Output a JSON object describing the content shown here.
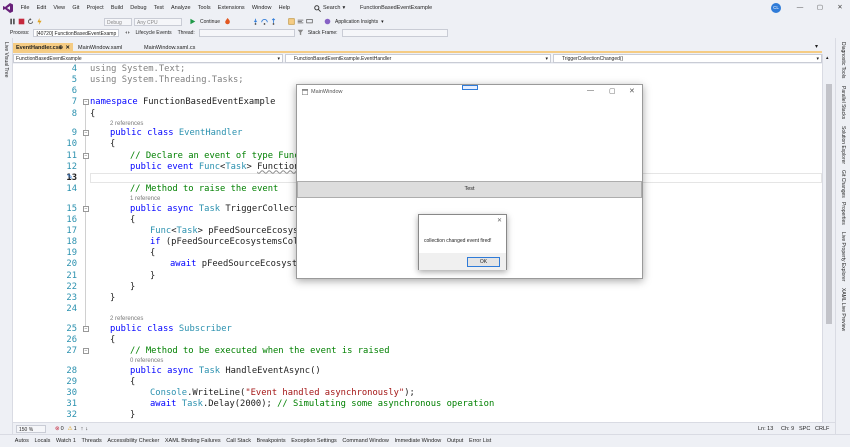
{
  "app": {
    "menu": [
      "File",
      "Edit",
      "View",
      "Git",
      "Project",
      "Build",
      "Debug",
      "Test",
      "Analyze",
      "Tools",
      "Extensions",
      "Window",
      "Help"
    ],
    "search_label": "Search",
    "solution_name": "FunctionBasedEventExample",
    "avatar_initials": "CL",
    "window_controls": [
      "—",
      "▢",
      "✕"
    ]
  },
  "toolbar": {
    "configuration": "Debug",
    "platform": "Any CPU",
    "continue_label": "Continue",
    "app_insights": "Application Insights"
  },
  "toolbar2": {
    "process_label": "Process:",
    "process_value": "[40720] FunctionBasedEventExamp",
    "lifecycle_label": "Lifecycle Events",
    "thread_label": "Thread:",
    "stack_frame_label": "Stack Frame:"
  },
  "left_rail": [
    "Live Visual Tree"
  ],
  "right_rail": [
    "Diagnostic Tools",
    "Parallel Stacks",
    "Solution Explorer",
    "Git Changes",
    "Properties",
    "Live Property Explorer",
    "XAML Live Preview"
  ],
  "tabs": [
    {
      "label": "EventHandler.cs",
      "active": true
    },
    {
      "label": "MainWindow.xaml",
      "active": false
    },
    {
      "label": "MainWindow.xaml.cs",
      "active": false
    }
  ],
  "navbar": {
    "project": "FunctionBasedEventExample",
    "type": "FunctionBasedEventExample.EventHandler",
    "member": "TriggerCollectionChanged()"
  },
  "editor": {
    "lines": [
      {
        "n": "4",
        "html": "<span class='gr'>using System.Text;</span>",
        "indent": 0
      },
      {
        "n": "5",
        "html": "<span class='gr'>using System.Threading.Tasks;</span>",
        "indent": 0
      },
      {
        "n": "6",
        "html": "",
        "indent": 0
      },
      {
        "n": "7",
        "html": "<span class='kw'>namespace</span> FunctionBasedEventExample",
        "indent": 0
      },
      {
        "n": "8",
        "html": "{",
        "indent": 0
      },
      {
        "n": "9",
        "html": "<span class='kw'>public class</span> <span class='ty'>EventHandler</span>",
        "indent": 1,
        "ref": "2 references"
      },
      {
        "n": "10",
        "html": "{",
        "indent": 1
      },
      {
        "n": "11",
        "html": "<span class='cm'>// Declare an event of type Func&lt;</span>",
        "indent": 2
      },
      {
        "n": "12",
        "html": "<span class='kw'>public event</span> <span class='ty'>Func</span>&lt;<span class='ty'>Task</span>&gt; <u style='text-decoration-style:wavy;text-decoration-color:#8c8c8c'>FunctionE</u>",
        "indent": 2
      },
      {
        "n": "13",
        "html": "",
        "indent": 2,
        "current": true
      },
      {
        "n": "14",
        "html": "<span class='cm'>// Method to raise the event</span>",
        "indent": 2
      },
      {
        "n": "15",
        "html": "<span class='kw'>public async</span> <span class='ty'>Task</span> TriggerCollecti",
        "indent": 2,
        "ref": "1 reference"
      },
      {
        "n": "16",
        "html": "{",
        "indent": 2
      },
      {
        "n": "17",
        "html": "<span class='ty'>Func</span>&lt;<span class='ty'>Task</span>&gt; pFeedSourceEcosyst",
        "indent": 3
      },
      {
        "n": "18",
        "html": "<span class='kw'>if</span> (pFeedSourceEcosystemsColl",
        "indent": 3
      },
      {
        "n": "19",
        "html": "{",
        "indent": 3
      },
      {
        "n": "20",
        "html": "<span class='kw'>await</span> pFeedSourceEcosyste",
        "indent": 4
      },
      {
        "n": "21",
        "html": "}",
        "indent": 3
      },
      {
        "n": "22",
        "html": "}",
        "indent": 2
      },
      {
        "n": "23",
        "html": "}",
        "indent": 1
      },
      {
        "n": "24",
        "html": "",
        "indent": 0
      },
      {
        "n": "25",
        "html": "<span class='kw'>public class</span> <span class='ty'>Subscriber</span>",
        "indent": 1,
        "ref": "2 references"
      },
      {
        "n": "26",
        "html": "{",
        "indent": 1
      },
      {
        "n": "27",
        "html": "<span class='cm'>// Method to be executed when the event is raised</span>",
        "indent": 2
      },
      {
        "n": "28",
        "html": "<span class='kw'>public async</span> <span class='ty'>Task</span> HandleEventAsync()",
        "indent": 2,
        "ref": "0 references"
      },
      {
        "n": "29",
        "html": "{",
        "indent": 2
      },
      {
        "n": "30",
        "html": "<span class='ty'>Console</span>.WriteLine(<span class='st'>\"Event handled asynchronously\"</span>);",
        "indent": 3
      },
      {
        "n": "31",
        "html": "<span class='kw'>await</span> <span class='ty'>Task</span>.Delay(2000); <span class='cm'>// Simulating some asynchronous operation</span>",
        "indent": 3
      },
      {
        "n": "32",
        "html": "}",
        "indent": 2
      }
    ]
  },
  "status": {
    "zoom": "150 %",
    "errors": "0",
    "warnings": "1",
    "issues_icon": "issues-icon",
    "ln": "Ln: 13",
    "ch": "Ch: 9",
    "spc": "SPC",
    "crlf": "CRLF"
  },
  "bottom_tabs": [
    "Autos",
    "Locals",
    "Watch 1",
    "Threads",
    "Accessibility Checker",
    "XAML Binding Failures",
    "Call Stack",
    "Breakpoints",
    "Exception Settings",
    "Command Window",
    "Immediate Window",
    "Output",
    "Error List"
  ],
  "wpf_window": {
    "title": "MainWindow",
    "button_label": "Test"
  },
  "message_box": {
    "text": "collection changed event fired!",
    "ok_label": "OK"
  }
}
